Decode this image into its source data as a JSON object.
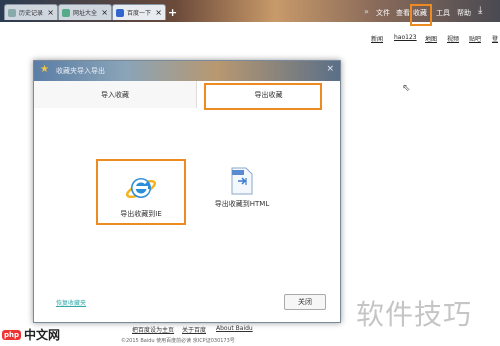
{
  "browser": {
    "tabs": [
      {
        "label": "历史记录",
        "color": "#8aa"
      },
      {
        "label": "网址大全",
        "color": "#5a8"
      },
      {
        "label": "百度一下",
        "color": "#36c"
      }
    ],
    "new_tab": "+",
    "chevron": "»",
    "menu": [
      "文件",
      "查看",
      "收藏",
      "工具",
      "帮助"
    ],
    "download_icon": "download-icon"
  },
  "top_links": [
    "新闻",
    "hao123",
    "地图",
    "视频",
    "贴吧",
    "登"
  ],
  "dialog": {
    "title": "收藏夹导入导出",
    "close_glyph": "×",
    "tabs": [
      "导入收藏",
      "导出收藏"
    ],
    "options": [
      {
        "label": "导出收藏到IE",
        "icon": "ie-icon"
      },
      {
        "label": "导出收藏到HTML",
        "icon": "html-file-icon"
      }
    ],
    "restore_link": "恢复收藏夹",
    "close_button": "关闭"
  },
  "footer": {
    "links": [
      "把百度设为主页",
      "关于百度",
      "About Baidu"
    ],
    "copyright": "©2015 Baidu 使用百度前必读 京ICP证030173号"
  },
  "watermark": {
    "text": "软件技巧",
    "logo_brand": "php",
    "logo_text": "中文网"
  },
  "colors": {
    "highlight": "#ee8a22",
    "overlay": "#000000"
  }
}
